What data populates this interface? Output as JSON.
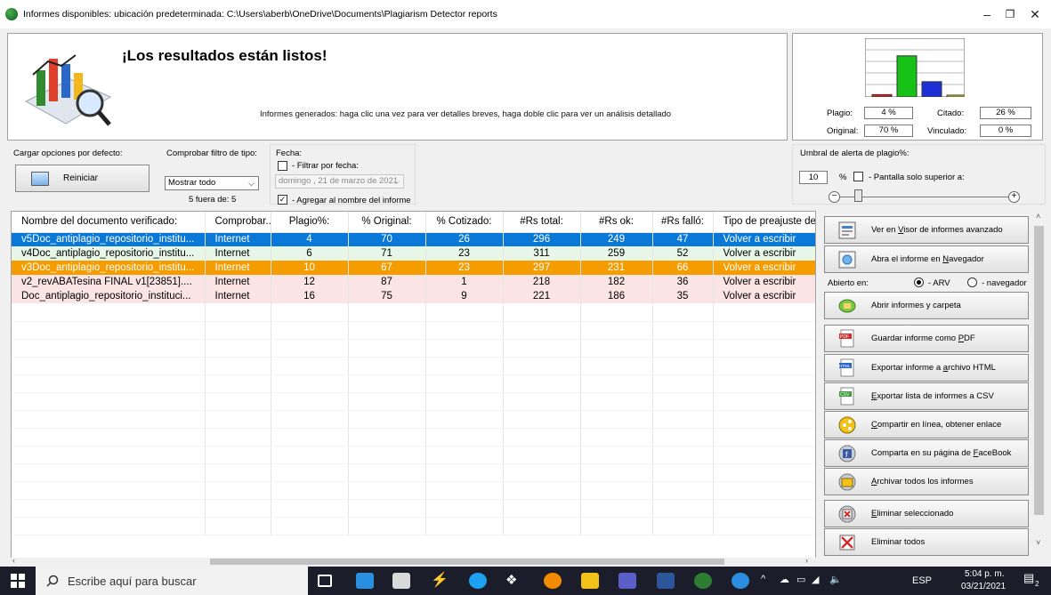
{
  "window": {
    "title": "Informes disponibles: ubicación predeterminada: C:\\Users\\aberb\\OneDrive\\Documents\\Plagiarism Detector reports",
    "minimize": "–",
    "maximize": "❐",
    "close": "✕"
  },
  "header": {
    "title": "¡Los resultados están listos!",
    "subtitle": "Informes generados: haga clic una vez para ver detalles breves, haga doble clic para ver un análisis detallado"
  },
  "stats": {
    "plagio_label": "Plagio:",
    "plagio_value": "4 %",
    "citado_label": "Citado:",
    "citado_value": "26 %",
    "original_label": "Original:",
    "original_value": "70 %",
    "vinculado_label": "Vinculado:",
    "vinculado_value": "0 %",
    "chart_colors": [
      "#e51a1a",
      "#15c215",
      "#1f2fd6",
      "#e3d31c"
    ],
    "chart_levels": [
      0.04,
      0.7,
      0.26,
      0.02
    ]
  },
  "options": {
    "defaults_label": "Cargar opciones por defecto:",
    "reset_label": "Reiniciar",
    "type_filter_label": "Comprobar filtro de tipo:",
    "type_filter_value": "Mostrar todo",
    "type_count": "5 fuera de: 5",
    "date_label": "Fecha:",
    "filter_by_date": "- Filtrar por fecha:",
    "date_value": "domingo , 21 de   marzo   de 2021",
    "add_to_name": "- Agregar al nombre del informe",
    "threshold_label": "Umbral de alerta de plagio%:",
    "threshold_value": "10",
    "percent_sign": "%",
    "top_screen_label": "- Pantalla solo superior a:"
  },
  "table": {
    "columns": [
      "Nombre del documento verificado:",
      "Comprobar...",
      "Plagio%:",
      "% Original:",
      "% Cotizado:",
      "#Rs total:",
      "#Rs ok:",
      "#Rs falló:",
      "Tipo de preajuste de"
    ],
    "rows": [
      {
        "name": "v5Doc_antiplagio_repositorio_institu...",
        "check": "Internet",
        "plagio": "4",
        "original": "70",
        "cotizado": "26",
        "total": "296",
        "ok": "249",
        "fail": "47",
        "preset": "Volver a escribir",
        "style": "blue"
      },
      {
        "name": "v4Doc_antiplagio_repositorio_institu...",
        "check": "Internet",
        "plagio": "6",
        "original": "71",
        "cotizado": "23",
        "total": "311",
        "ok": "259",
        "fail": "52",
        "preset": "Volver a escribir",
        "style": "green"
      },
      {
        "name": "v3Doc_antiplagio_repositorio_institu...",
        "check": "Internet",
        "plagio": "10",
        "original": "67",
        "cotizado": "23",
        "total": "297",
        "ok": "231",
        "fail": "66",
        "preset": "Volver a escribir",
        "style": "orange"
      },
      {
        "name": "v2_revABATesina FINAL v1[23851]....",
        "check": "Internet",
        "plagio": "12",
        "original": "87",
        "cotizado": "1",
        "total": "218",
        "ok": "182",
        "fail": "36",
        "preset": "Volver a escribir",
        "style": "pink"
      },
      {
        "name": "Doc_antiplagio_repositorio_instituci...",
        "check": "Internet",
        "plagio": "16",
        "original": "75",
        "cotizado": "9",
        "total": "221",
        "ok": "186",
        "fail": "35",
        "preset": "Volver a escribir",
        "style": "pink"
      }
    ]
  },
  "actions": {
    "advanced_viewer": [
      "Ver en ",
      "V",
      "isor de informes avanzado"
    ],
    "open_browser": [
      "Abra el informe en ",
      "N",
      "avegador"
    ],
    "open_in_label": "Abierto en:",
    "open_in_arv": "- ARV",
    "open_in_browser": "- navegador",
    "open_folder": "Abrir informes y carpeta",
    "save_pdf": [
      "Guardar informe como ",
      "P",
      "DF"
    ],
    "export_html": [
      "Exportar informe a ",
      "a",
      "rchivo HTML"
    ],
    "export_csv": [
      "E",
      "xportar lista de informes a CSV"
    ],
    "share_online": [
      "C",
      "ompartir en línea, obtener enlace"
    ],
    "share_facebook": [
      "Comparta en su página de ",
      "F",
      "aceBook"
    ],
    "archive_all": [
      "A",
      "rchivar todos los informes"
    ],
    "delete_selected": [
      "E",
      "liminar seleccionado"
    ],
    "delete_all": "Eliminar todos"
  },
  "taskbar": {
    "search_placeholder": "Escribe aquí para buscar",
    "time": "5:04 p. m.",
    "date": "03/21/2021",
    "language": "ESP",
    "notification_count": "2"
  }
}
